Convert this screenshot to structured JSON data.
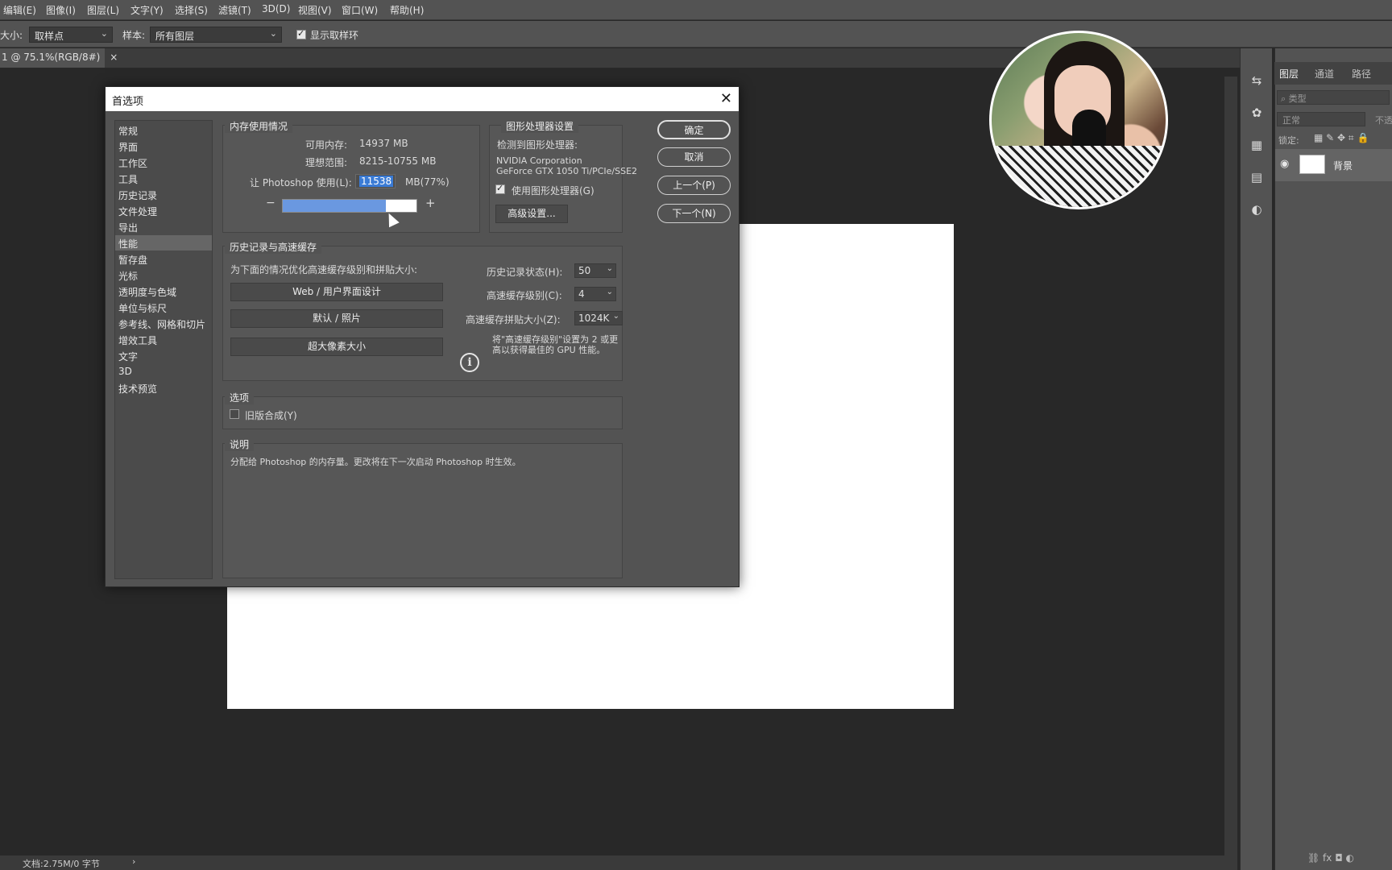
{
  "menubar": {
    "items": [
      "编辑(E)",
      "图像(I)",
      "图层(L)",
      "文字(Y)",
      "选择(S)",
      "滤镜(T)",
      "3D(D)",
      "视图(V)",
      "窗口(W)",
      "帮助(H)"
    ]
  },
  "options_bar": {
    "size_label": "大小:",
    "size_value": "取样点",
    "sample_label": "样本:",
    "sample_value": "所有图层",
    "show_ring_label": "显示取样环",
    "show_ring_checked": true
  },
  "doc_tab": {
    "title": "1 @ 75.1%(RGB/8#)",
    "close": "×"
  },
  "status": {
    "doc_info": "文档:2.75M/0 字节",
    "arrow": "›"
  },
  "layers_panel": {
    "tabs": [
      "图层",
      "通道",
      "路径"
    ],
    "filter_placeholder": "类型",
    "blend_mode": "正常",
    "opacity_label": "不透",
    "lock_label": "锁定:",
    "layer_name": "背景"
  },
  "dialog": {
    "title": "首选项",
    "close": "✕",
    "nav": [
      "常规",
      "界面",
      "工作区",
      "工具",
      "历史记录",
      "文件处理",
      "导出",
      "性能",
      "暂存盘",
      "光标",
      "透明度与色域",
      "单位与标尺",
      "参考线、网格和切片",
      "增效工具",
      "文字",
      "3D",
      "技术预览"
    ],
    "nav_selected_index": 7,
    "memory": {
      "title": "内存使用情况",
      "available_label": "可用内存:",
      "available_value": "14937 MB",
      "ideal_label": "理想范围:",
      "ideal_value": "8215-10755 MB",
      "let_label": "让 Photoshop 使用(L):",
      "let_value": "11538",
      "unit": "MB(77%)",
      "minus": "−",
      "plus": "+",
      "slider_percent": 77
    },
    "gpu": {
      "title": "图形处理器设置",
      "detected_label": "检测到图形处理器:",
      "vendor": "NVIDIA Corporation",
      "model": "GeForce GTX 1050 Ti/PCIe/SSE2",
      "use_gpu_label": "使用图形处理器(G)",
      "use_gpu_checked": true,
      "advanced_button": "高级设置..."
    },
    "buttons": {
      "ok": "确定",
      "cancel": "取消",
      "prev": "上一个(P)",
      "next": "下一个(N)"
    },
    "history_cache": {
      "title": "历史记录与高速缓存",
      "optimize_label": "为下面的情况优化高速缓存级别和拼贴大小:",
      "preset_web": "Web / 用户界面设计",
      "preset_default": "默认 / 照片",
      "preset_huge": "超大像素大小",
      "history_states_label": "历史记录状态(H):",
      "history_states_value": "50",
      "cache_levels_label": "高速缓存级别(C):",
      "cache_levels_value": "4",
      "tile_size_label": "高速缓存拼贴大小(Z):",
      "tile_size_value": "1024K",
      "info_line1": "将\"高速缓存级别\"设置为 2 或更",
      "info_line2": "高以获得最佳的 GPU 性能。"
    },
    "options": {
      "title": "选项",
      "legacy_label": "旧版合成(Y)",
      "legacy_checked": false
    },
    "description": {
      "title": "说明",
      "text": "分配给 Photoshop 的内存量。更改将在下一次启动 Photoshop 时生效。"
    }
  }
}
